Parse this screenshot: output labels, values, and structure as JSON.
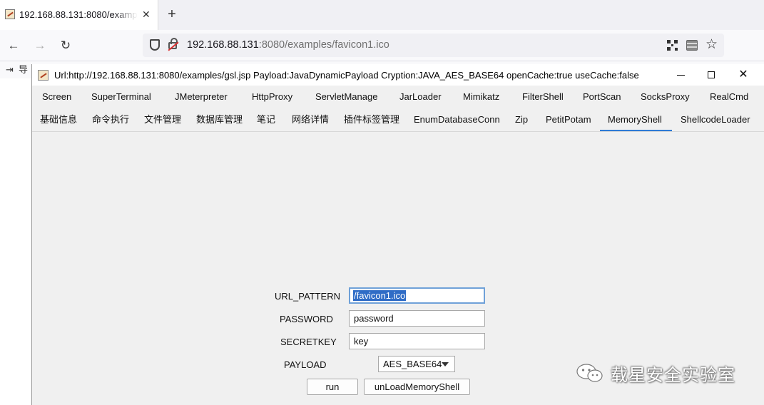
{
  "browser": {
    "tab_title": "192.168.88.131:8080/examples/favicon1.ico",
    "tab_close": "✕",
    "new_tab": "+",
    "back": "←",
    "forward": "→",
    "reload": "↻",
    "url_host": "192.168.88.131",
    "url_rest": ":8080/examples/favicon1.ico",
    "bookmark_icon": "⇥",
    "bookmark_label": "导"
  },
  "window": {
    "title": "Url:http://192.168.88.131:8080/examples/gsl.jsp Payload:JavaDynamicPayload Cryption:JAVA_AES_BASE64 openCache:true useCache:false",
    "close": "✕"
  },
  "tabs_row1": [
    "Screen",
    "SuperTerminal",
    "JMeterpreter",
    "HttpProxy",
    "ServletManage",
    "JarLoader",
    "Mimikatz",
    "FilterShell",
    "PortScan",
    "SocksProxy",
    "RealCmd"
  ],
  "tabs_row2": [
    "基础信息",
    "命令执行",
    "文件管理",
    "数据库管理",
    "笔记",
    "网络详情",
    "插件标签管理",
    "EnumDatabaseConn",
    "Zip",
    "PetitPotam",
    "MemoryShell",
    "ShellcodeLoader"
  ],
  "active_tab": "MemoryShell",
  "form": {
    "url_pattern_label": "URL_PATTERN",
    "url_pattern_value": "/favicon1.ico",
    "password_label": "PASSWORD",
    "password_value": "password",
    "secretkey_label": "SECRETKEY",
    "secretkey_value": "key",
    "payload_label": "PAYLOAD",
    "payload_value": "AES_BASE64",
    "run_button": "run",
    "unload_button": "unLoadMemoryShell"
  },
  "watermark": {
    "text": "载星安全实验室"
  },
  "colors": {
    "accent": "#2f7bd6",
    "selection": "#2f6cc6",
    "window_bg": "#f0f0f0"
  }
}
